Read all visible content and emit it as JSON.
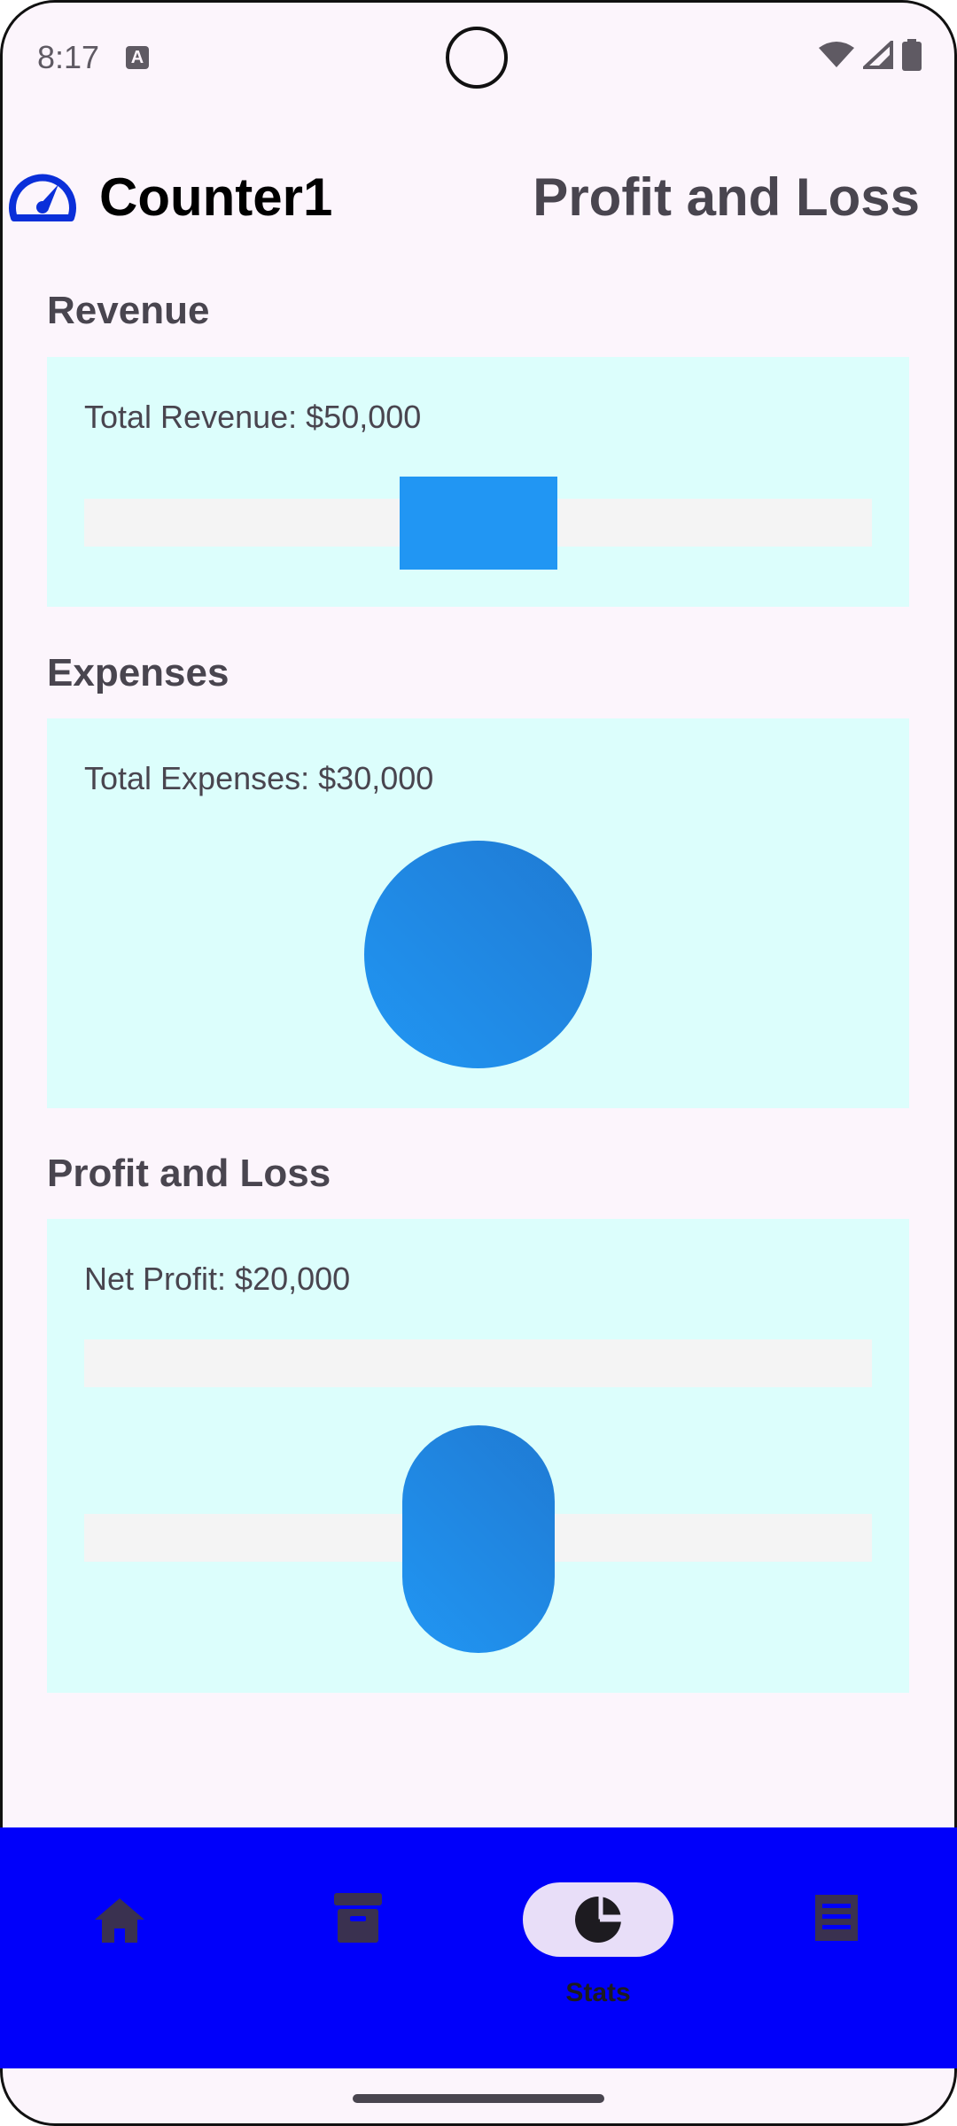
{
  "status_bar": {
    "time": "8:17",
    "keyboard_badge": "A"
  },
  "header": {
    "app_name": "Counter1",
    "page_title": "Profit and Loss"
  },
  "revenue": {
    "section_title": "Revenue",
    "label": "Total Revenue: $50,000"
  },
  "expenses": {
    "section_title": "Expenses",
    "label": "Total Expenses: $30,000"
  },
  "profit": {
    "section_title": "Profit and Loss",
    "label": "Net Profit: $20,000"
  },
  "nav": {
    "items": [
      {
        "icon": "home-icon",
        "label": ""
      },
      {
        "icon": "archive-icon",
        "label": ""
      },
      {
        "icon": "pie-chart-icon",
        "label": "Stats",
        "selected": true
      },
      {
        "icon": "receipt-icon",
        "label": ""
      }
    ]
  },
  "colors": {
    "accent_blue": "#2196f3",
    "card_background": "#dcfefc",
    "nav_background": "#0000fa",
    "selected_pill": "#e8def8"
  }
}
